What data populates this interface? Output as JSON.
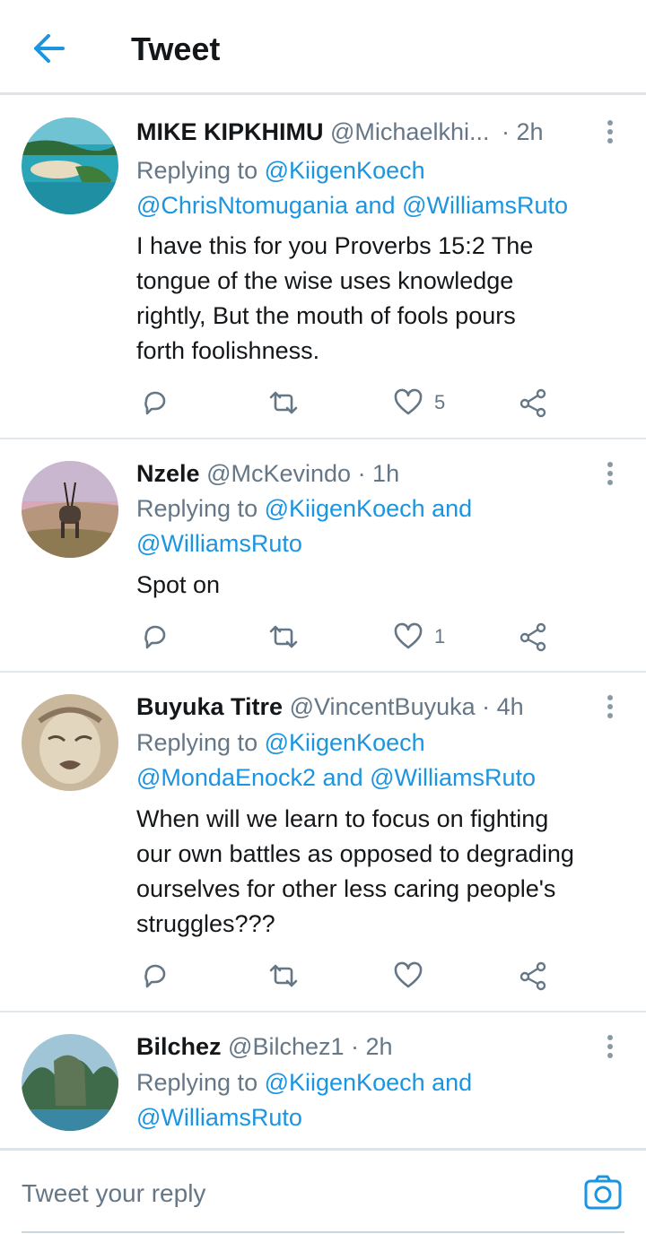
{
  "header": {
    "title": "Tweet",
    "back_icon": "arrow-left-icon"
  },
  "colors": {
    "accent": "#1b95e0",
    "secondary_text": "#657786",
    "divider": "#e1e8ed"
  },
  "replies": [
    {
      "name": "MIKE KIPKHIMU",
      "handle": "@Michaelkhi...",
      "time": "· 2h",
      "replying_prefix": "Replying to ",
      "replying_line1": "@KiigenKoech",
      "replying_line2_a": "@ChrisNtomugania",
      "replying_and": " and ",
      "replying_line2_b": "@WilliamsRuto",
      "text_lines": [
        "I have this for you Proverbs 15:2 The",
        "tongue of the wise uses knowledge",
        "rightly, But the mouth of fools pours",
        "forth foolishness."
      ],
      "like_count": "5"
    },
    {
      "name": "Nzele",
      "handle": "@McKevindo",
      "time": "· 1h",
      "replying_prefix": "Replying to ",
      "replying_line1": "@KiigenKoech",
      "replying_and": " and",
      "replying_line2": "@WilliamsRuto",
      "text_lines": [
        "Spot on"
      ],
      "like_count": "1"
    },
    {
      "name": "Buyuka Titre",
      "handle": "@VincentBuyuka",
      "time": "· 4h",
      "replying_prefix": "Replying to ",
      "replying_line1": "@KiigenKoech",
      "replying_line2_a": "@MondaEnock2",
      "replying_and": " and ",
      "replying_line2_b": "@WilliamsRuto",
      "text_lines": [
        "When will we learn to focus on fighting",
        "our own battles as opposed to degrading",
        "ourselves for other less caring people's",
        "struggles???"
      ],
      "like_count": ""
    },
    {
      "name": "Bilchez",
      "handle": "@Bilchez1",
      "time": "· 2h",
      "replying_prefix": "Replying to ",
      "replying_line1": "@KiigenKoech",
      "replying_and": " and",
      "replying_line2": "@WilliamsRuto"
    }
  ],
  "composer": {
    "placeholder": "Tweet your reply",
    "camera_icon": "camera-icon"
  }
}
